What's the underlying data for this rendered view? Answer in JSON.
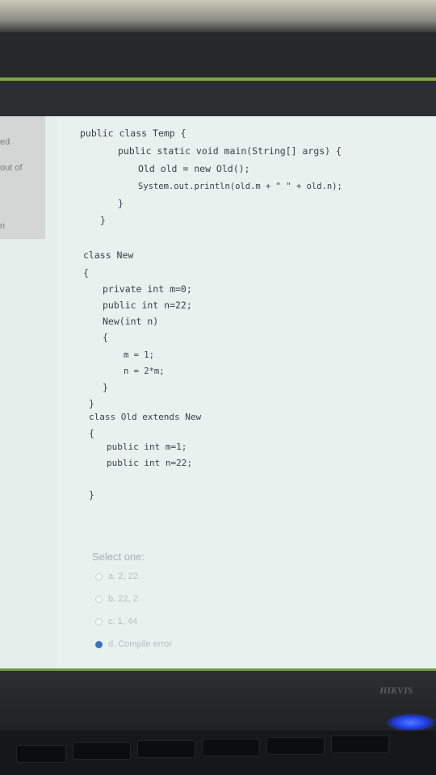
{
  "side_panel": {
    "line1": "ed",
    "line2": "out of",
    "line3": "n"
  },
  "code": {
    "lines": [
      "public class Temp {",
      "public static void main(String[] args) {",
      "Old old = new Old();",
      "System.out.println(old.m + \" \" + old.n);",
      "}",
      "}",
      "class New",
      "{",
      "private int m=0;",
      "public int n=22;",
      "New(int n)",
      "{",
      "m = 1;",
      "n = 2*m;",
      "}",
      "}",
      "class Old extends New",
      "{",
      "public int m=1;",
      "public int n=22;",
      "}"
    ]
  },
  "question": {
    "select_label": "Select one:",
    "options": [
      {
        "label": "a. 2, 22",
        "selected": false
      },
      {
        "label": "b. 22, 2",
        "selected": false
      },
      {
        "label": "c. 1, 44",
        "selected": false
      },
      {
        "label": "d. Compile error",
        "selected": true
      }
    ]
  },
  "monitor": {
    "brand": "HIKVIS"
  },
  "colors": {
    "accent_green": "#7fa84a",
    "radio_selected": "#3a6fc8"
  }
}
